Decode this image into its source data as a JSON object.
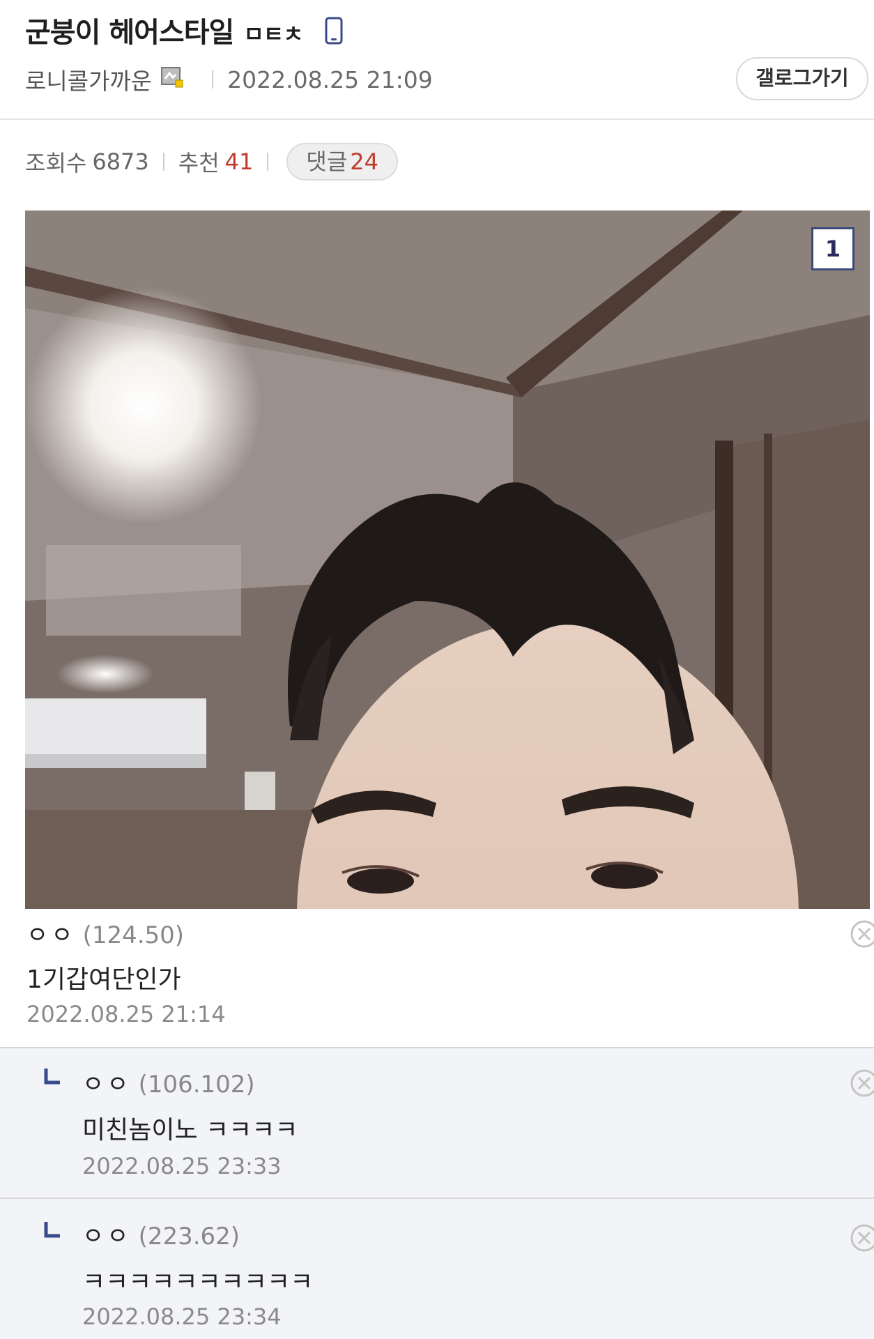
{
  "post": {
    "title": "군붕이 헤어스타일",
    "title_suffix": "ㅁㅌㅊ",
    "author": "로니콜가까운",
    "date": "2022.08.25 21:09",
    "gallery_button": "갤로그가기",
    "views_label": "조회수",
    "views": "6873",
    "recommend_label": "추천",
    "recommend": "41",
    "comments_label": "댓글",
    "comments": "24",
    "image_badge": "1"
  },
  "comments": [
    {
      "name": "ㅇㅇ",
      "ip": "(124.50)",
      "text": "1기갑여단인가",
      "date": "2022.08.25 21:14"
    },
    {
      "name": "ㅇㅇ",
      "ip": "(106.102)",
      "text": "미친놈이노 ㅋㅋㅋㅋ",
      "date": "2022.08.25 23:33"
    },
    {
      "name": "ㅇㅇ",
      "ip": "(223.62)",
      "text": "ㅋㅋㅋㅋㅋㅋㅋㅋㅋㅋ",
      "date": "2022.08.25 23:34"
    }
  ],
  "colors": {
    "accent_red": "#c0392b",
    "reply_blue": "#3a4a8a",
    "reply_bg": "#f3f4f7"
  },
  "icons": [
    "mobile-phone-icon",
    "gallery-level-icon",
    "reply-arrow-icon",
    "delete-x-icon"
  ]
}
